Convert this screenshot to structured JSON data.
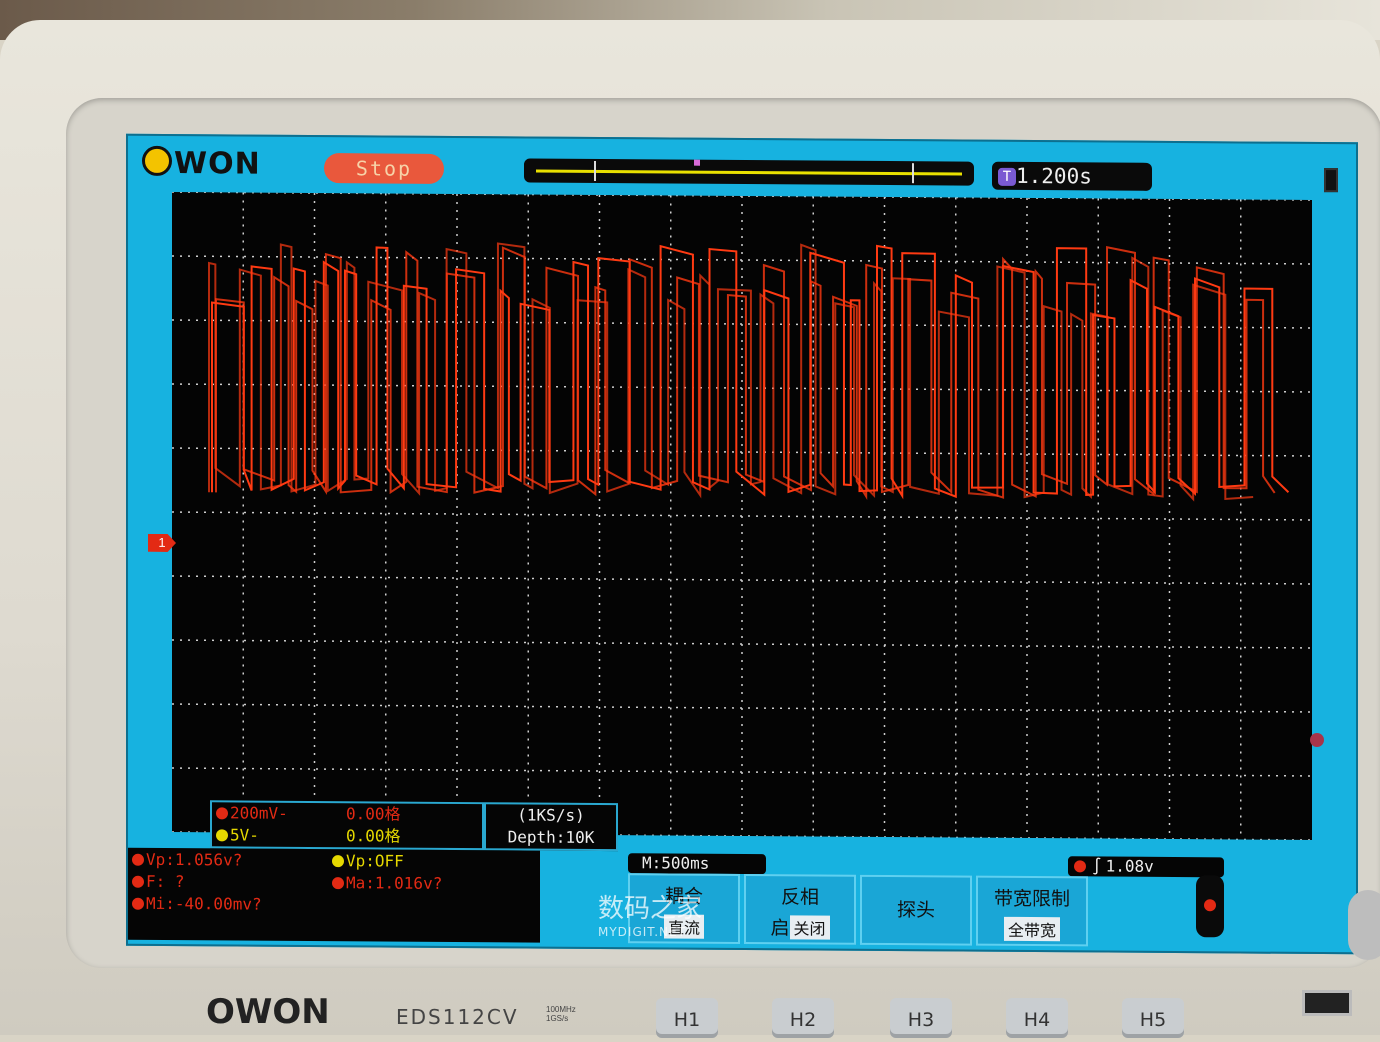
{
  "device": {
    "brand": "OWON",
    "model": "EDS112CV",
    "spec": [
      "100MHz",
      "1GS/s"
    ]
  },
  "screen": {
    "logo": "OWON",
    "run_state": "Stop",
    "trigger_time": "1.200s",
    "trigger_badge": "T"
  },
  "channels": [
    {
      "scale": "200mV-",
      "offset": "0.00格",
      "color": "#e32a14"
    },
    {
      "scale": "5V-",
      "offset": "0.00格",
      "color": "#e5d800"
    }
  ],
  "acquisition": {
    "rate": "(1KS/s)",
    "depth": "Depth:10K"
  },
  "measurements": [
    {
      "label": "Vp:1.056v?",
      "color": "#e32a14"
    },
    {
      "label": "Vp:OFF",
      "color": "#e5d800"
    },
    {
      "label": "F:  ?",
      "color": "#e32a14"
    },
    {
      "label": "Ma:1.016v?",
      "color": "#e32a14"
    },
    {
      "label": "Mi:-40.00mv?",
      "color": "#e32a14"
    }
  ],
  "timebase": "M:500ms",
  "trigger_level": "1.08v",
  "menu": [
    {
      "label": "耦合",
      "value": "直流"
    },
    {
      "label": "反相",
      "value": "关闭",
      "prefix": "启"
    },
    {
      "label": "探头",
      "value": ""
    },
    {
      "label": "带宽限制",
      "value": "全带宽"
    }
  ],
  "watermark": {
    "text": "数码之家",
    "sub": "MYDIGIT.NET"
  },
  "hardware_buttons": [
    "H1",
    "H2",
    "H3",
    "H4",
    "H5"
  ],
  "colors": {
    "screen_bg": "#17b2e0",
    "trace": "#ff3a12",
    "bezel": "#e3e0d6"
  }
}
